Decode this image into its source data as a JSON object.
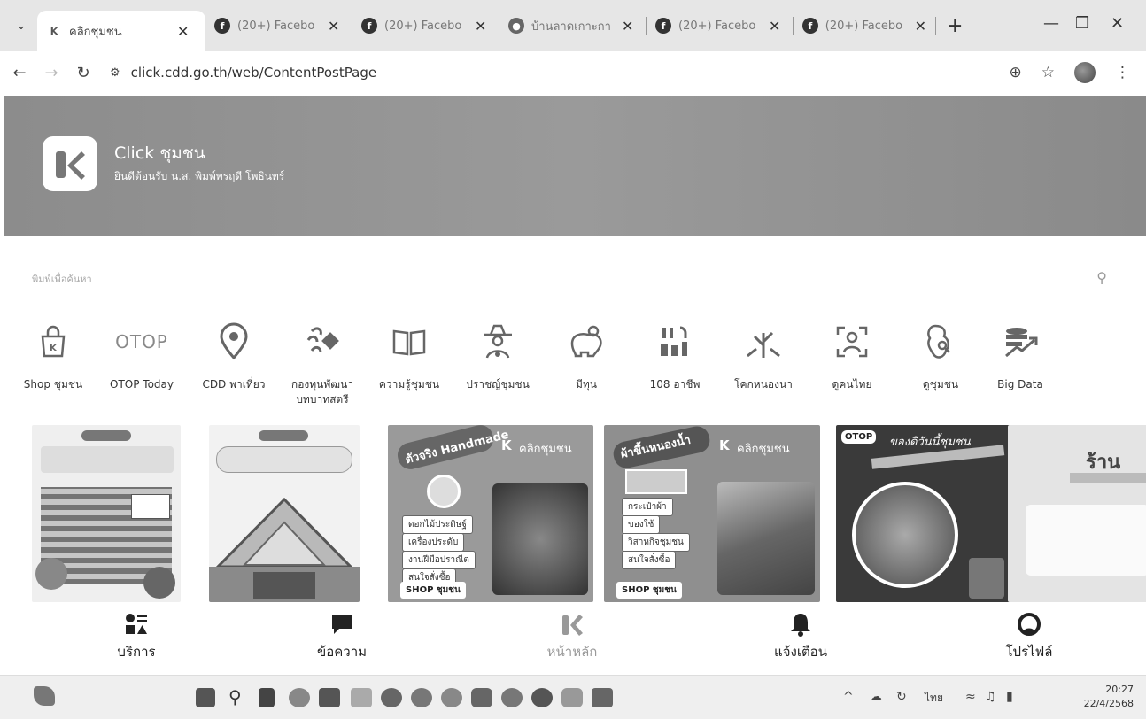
{
  "browser": {
    "tabs": [
      {
        "icon": "click-app-favicon",
        "title": "คลิกชุมชน",
        "active": true
      },
      {
        "icon": "facebook-icon",
        "title": "(20+) Facebo"
      },
      {
        "icon": "facebook-icon",
        "title": "(20+) Facebo"
      },
      {
        "icon": "globe-icon",
        "title": "บ้านลาดเกาะกา"
      },
      {
        "icon": "facebook-icon",
        "title": "(20+) Facebo"
      },
      {
        "icon": "facebook-icon",
        "title": "(20+) Facebo"
      }
    ],
    "url": "click.cdd.go.th/web/ContentPostPage"
  },
  "banner": {
    "app_name": "Click ชุมชน",
    "welcome": "ยินดีต้อนรับ น.ส. พิมพ์พรฤดี โพธินทร์"
  },
  "search": {
    "placeholder": "พิมพ์เพื่อค้นหา"
  },
  "services": [
    {
      "label": "Shop ชุมชน",
      "icon": "shopping-bag-icon"
    },
    {
      "label": "OTOP Today",
      "icon": "otop-logo-icon"
    },
    {
      "label": "CDD พาเที่ยว",
      "icon": "map-pin-icon"
    },
    {
      "label": "กองทุนพัฒนาบทบาทสตรี",
      "icon": "women-fund-icon"
    },
    {
      "label": "ความรู้ชุมชน",
      "icon": "open-book-icon"
    },
    {
      "label": "ปราชญ์ชุมชน",
      "icon": "sage-person-icon"
    },
    {
      "label": "มีทุน",
      "icon": "piggy-bank-icon"
    },
    {
      "label": "108 อาชีพ",
      "icon": "tools-icon"
    },
    {
      "label": "โคกหนองนา",
      "icon": "sprout-icon"
    },
    {
      "label": "ดูคนไทย",
      "icon": "person-scan-icon"
    },
    {
      "label": "ดูชุมชน",
      "icon": "map-search-icon"
    },
    {
      "label": "Big Data",
      "icon": "database-chart-icon"
    }
  ],
  "posters": {
    "p3_title": "ตัวจริง Handmade",
    "p3_items": [
      "ดอกไม้ประดิษฐ์",
      "เครื่องประดับ",
      "งานฝีมือปราณีต",
      "สนใจสั่งซื้อ"
    ],
    "p4_title": "ผ้าขึ้นหนองน้ำ",
    "p4_items": [
      "กระเป๋าผ้า",
      "ของใช้",
      "วิสาหกิจชุมชน",
      "สนใจสั่งซื้อ"
    ],
    "brand": "คลิกชุมชน",
    "shop_tag": "SHOP ชุมชน",
    "p5_brand": "OTOP",
    "p5_title": "ของดีวันนี้ชุมชน",
    "p6_title": "ร้าน"
  },
  "bottom_nav": [
    {
      "label": "บริการ",
      "icon": "services-grid-icon"
    },
    {
      "label": "ข้อความ",
      "icon": "message-icon"
    },
    {
      "label": "หน้าหลัก",
      "icon": "home-logo-icon"
    },
    {
      "label": "แจ้งเตือน",
      "icon": "bell-icon"
    },
    {
      "label": "โปรไฟล์",
      "icon": "profile-icon"
    }
  ],
  "taskbar": {
    "language": "ไทย",
    "time": "20:27",
    "date": "22/4/2568"
  }
}
